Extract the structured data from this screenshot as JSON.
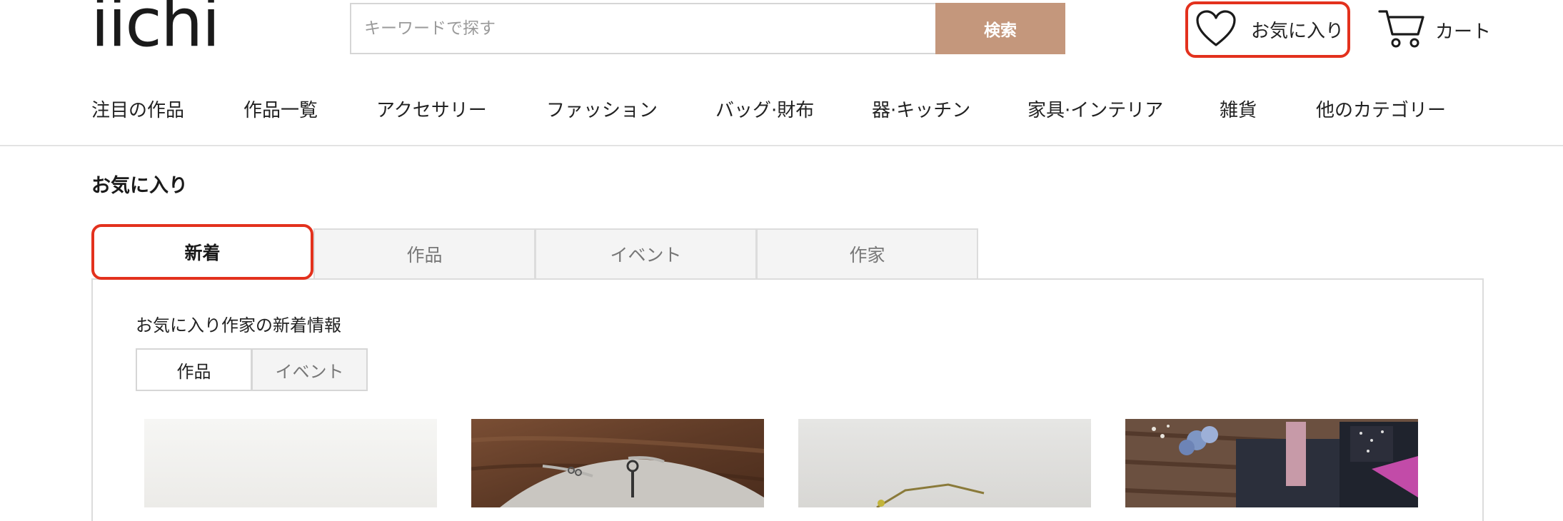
{
  "header": {
    "logo": "iichi",
    "search_placeholder": "キーワードで探す",
    "search_button": "検索",
    "favorites_label": "お気に入り",
    "cart_label": "カート"
  },
  "nav": {
    "items": [
      "注目の作品",
      "作品一覧",
      "アクセサリー",
      "ファッション",
      "バッグ·財布",
      "器·キッチン",
      "家具·インテリア",
      "雑貨",
      "他のカテゴリー"
    ]
  },
  "page": {
    "title": "お気に入り",
    "tabs": [
      "新着",
      "作品",
      "イベント",
      "作家"
    ],
    "active_tab": "新着",
    "section_heading": "お気に入り作家の新着情報",
    "subtabs": [
      "作品",
      "イベント"
    ],
    "active_subtab": "作品"
  },
  "colors": {
    "accent": "#c4977c",
    "highlight": "#e3311d"
  },
  "icons": [
    "heart-icon",
    "cart-icon"
  ]
}
